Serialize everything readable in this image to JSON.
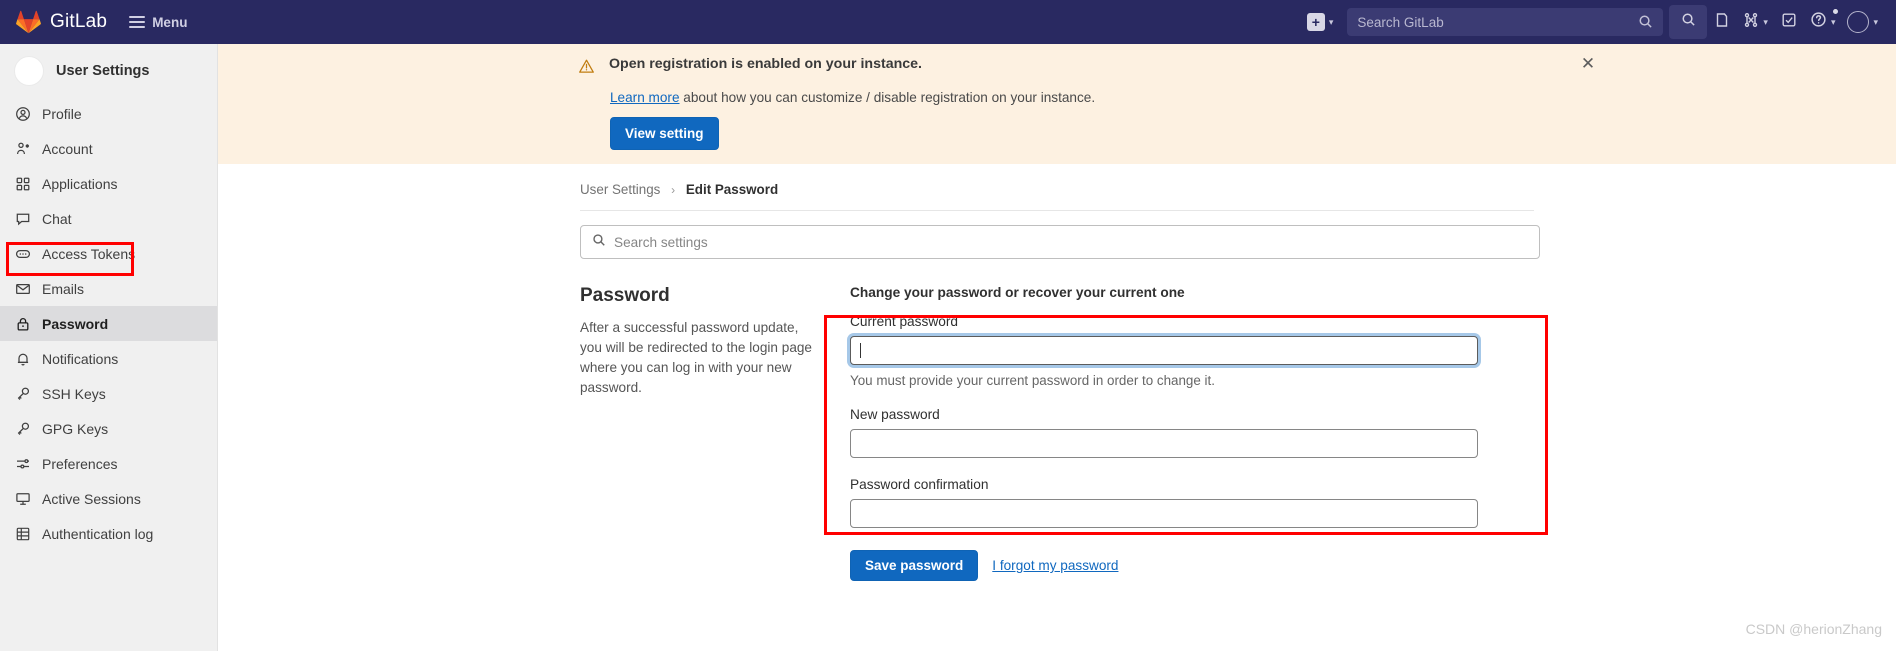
{
  "navbar": {
    "brand": "GitLab",
    "brand_logo_icon": "gitlab-tanuki-logo",
    "menu_label": "Menu",
    "hamburger_icon": "hamburger-icon",
    "new_icon": "plus-square-icon",
    "new_chevron_icon": "chevron-down-icon",
    "search_placeholder": "Search GitLab",
    "search_icon": "search-icon",
    "nav_search_icon": "search-icon",
    "issues_icon": "issues-icon",
    "merge_requests_icon": "merge-request-icon",
    "merge_requests_chevron_icon": "chevron-down-icon",
    "todos_icon": "todo-checkbox-icon",
    "help_icon": "question-circle-icon",
    "help_chevron_icon": "chevron-down-icon",
    "avatar_icon": "user-avatar",
    "avatar_chevron_icon": "chevron-down-icon",
    "background_color": "#292961"
  },
  "sidebar": {
    "title": "User Settings",
    "avatar_icon": "user-avatar",
    "items": [
      {
        "label": "Profile",
        "icon": "profile-icon",
        "active": false
      },
      {
        "label": "Account",
        "icon": "account-icon",
        "active": false
      },
      {
        "label": "Applications",
        "icon": "applications-grid-icon",
        "active": false
      },
      {
        "label": "Chat",
        "icon": "chat-bubble-icon",
        "active": false
      },
      {
        "label": "Access Tokens",
        "icon": "access-token-icon",
        "active": false
      },
      {
        "label": "Emails",
        "icon": "envelope-icon",
        "active": false
      },
      {
        "label": "Password",
        "icon": "lock-icon",
        "active": true
      },
      {
        "label": "Notifications",
        "icon": "bell-icon",
        "active": false
      },
      {
        "label": "SSH Keys",
        "icon": "key-icon",
        "active": false
      },
      {
        "label": "GPG Keys",
        "icon": "key-icon",
        "active": false
      },
      {
        "label": "Preferences",
        "icon": "sliders-icon",
        "active": false
      },
      {
        "label": "Active Sessions",
        "icon": "monitor-icon",
        "active": false
      },
      {
        "label": "Authentication log",
        "icon": "log-grid-icon",
        "active": false
      }
    ]
  },
  "alert": {
    "warning_icon": "warning-triangle-icon",
    "title": "Open registration is enabled on your instance.",
    "body_link": "Learn more",
    "body_rest": " about how you can customize / disable registration on your instance.",
    "button_label": "View setting",
    "close_icon": "close-icon",
    "background_color": "#fdf1e1"
  },
  "breadcrumb": {
    "parent": "User Settings",
    "separator": "›",
    "current": "Edit Password"
  },
  "settings_search": {
    "placeholder": "Search settings",
    "value": "",
    "icon": "search-icon"
  },
  "section": {
    "heading": "Password",
    "description": "After a successful password update, you will be redirected to the login page where you can log in with your new password.",
    "form_intro": "Change your password or recover your current one",
    "fields": [
      {
        "label": "Current password",
        "value": "",
        "help": "You must provide your current password in order to change it.",
        "focused": true
      },
      {
        "label": "New password",
        "value": "",
        "help": "",
        "focused": false
      },
      {
        "label": "Password confirmation",
        "value": "",
        "help": "",
        "focused": false
      }
    ],
    "save_label": "Save password",
    "forgot_label": "I forgot my password"
  },
  "annotations": {
    "highlight_color": "#ff0000"
  },
  "watermark": "CSDN @herionZhang"
}
